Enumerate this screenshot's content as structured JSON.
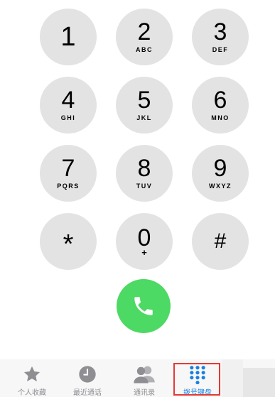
{
  "keypad": {
    "keys": [
      {
        "digit": "1",
        "letters": ""
      },
      {
        "digit": "2",
        "letters": "ABC"
      },
      {
        "digit": "3",
        "letters": "DEF"
      },
      {
        "digit": "4",
        "letters": "GHI"
      },
      {
        "digit": "5",
        "letters": "JKL"
      },
      {
        "digit": "6",
        "letters": "MNO"
      },
      {
        "digit": "7",
        "letters": "PQRS"
      },
      {
        "digit": "8",
        "letters": "TUV"
      },
      {
        "digit": "9",
        "letters": "WXYZ"
      },
      {
        "digit": "*",
        "letters": ""
      },
      {
        "digit": "0",
        "letters": "+"
      },
      {
        "digit": "#",
        "letters": ""
      }
    ],
    "key_color": "#e3e3e3"
  },
  "call_button": {
    "icon": "phone-icon",
    "color": "#4cd964"
  },
  "tabbar": {
    "tabs": [
      {
        "label": "个人收藏",
        "icon": "star-icon",
        "active": false
      },
      {
        "label": "最近通话",
        "icon": "clock-icon",
        "active": false
      },
      {
        "label": "通讯录",
        "icon": "contacts-icon",
        "active": false
      },
      {
        "label": "拨号键盘",
        "icon": "keypad-icon",
        "active": true
      }
    ],
    "active_color": "#1a7fe0",
    "inactive_color": "#8e8e93",
    "highlight_color": "#e53935"
  }
}
